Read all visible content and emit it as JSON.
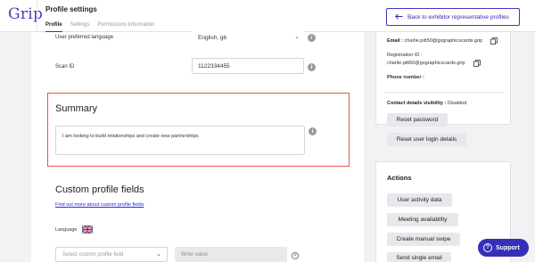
{
  "app": {
    "logo_text": "Grip",
    "brand_color": "#3530b5",
    "accent_link_color": "#2b2bd0",
    "highlight_border_color": "#e2574c"
  },
  "header": {
    "title": "Profile settings",
    "tabs": [
      {
        "label": "Profile",
        "active": true
      },
      {
        "label": "Settings",
        "active": false
      },
      {
        "label": "Permissions information",
        "active": false
      }
    ],
    "back_button": {
      "icon": "arrow-left-icon",
      "label": "Back to exhibitor representative profiles"
    }
  },
  "form": {
    "language": {
      "label": "User preferred language",
      "value": "English, gb"
    },
    "scan_id": {
      "label": "Scan ID",
      "value": "1122334455"
    },
    "summary": {
      "title": "Summary",
      "value": "I am looking to build relationships and create new partnerships."
    },
    "custom_fields": {
      "title": "Custom profile fields",
      "link": "Find out more about custom profile fields",
      "language_label": "Language",
      "language_flag": "uk-flag-icon",
      "field_placeholder": "Select custom profile field",
      "value_placeholder": "Write value"
    }
  },
  "contact": {
    "email_label": "Email :",
    "email_value": "charlie.pitt50@gxgraphicscards.grip",
    "registration_label": "Registration ID :",
    "registration_value": "charlie.pitt50@gxgraphicscards.grip",
    "phone_label": "Phone number :",
    "visibility_label": "Contact details visibility :",
    "visibility_value": "Disabled",
    "buttons": [
      "Reset password",
      "Reset user login details"
    ]
  },
  "actions": {
    "title": "Actions",
    "buttons": [
      "User activity data",
      "Meeting availability",
      "Create manual swipe",
      "Send single email"
    ]
  },
  "support": {
    "label": "Support",
    "icon": "question-icon"
  }
}
